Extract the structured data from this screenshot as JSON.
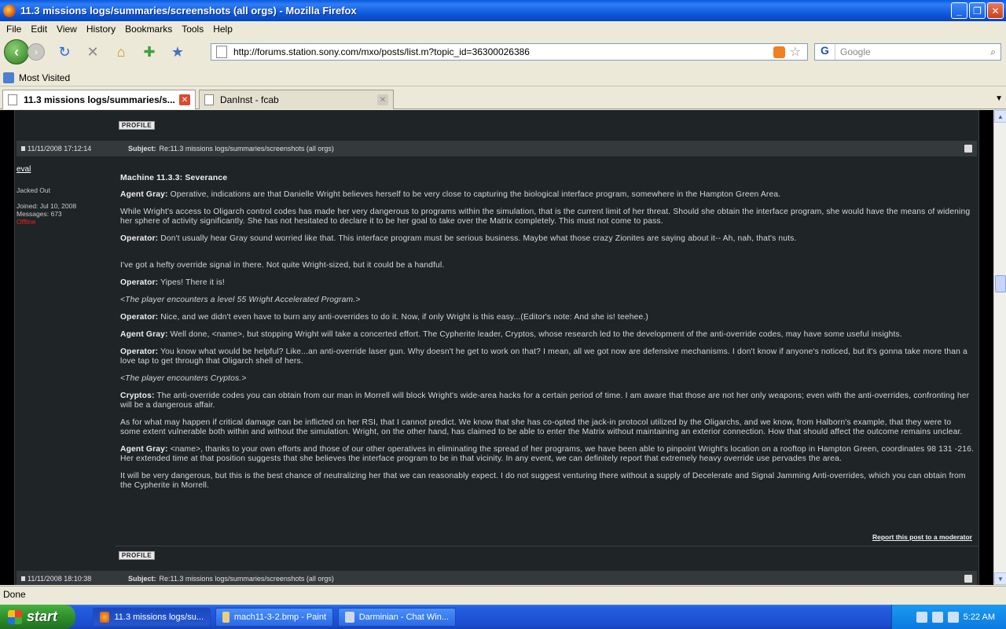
{
  "window": {
    "title": "11.3 missions logs/summaries/screenshots (all orgs) - Mozilla Firefox",
    "min": "_",
    "max": "❐",
    "close": "✕"
  },
  "menu": [
    "File",
    "Edit",
    "View",
    "History",
    "Bookmarks",
    "Tools",
    "Help"
  ],
  "nav": {
    "url": "http://forums.station.sony.com/mxo/posts/list.m?topic_id=36300026386",
    "search_placeholder": "Google",
    "search_engine": "G"
  },
  "bookmarks": {
    "most_visited": "Most Visited"
  },
  "tabs": [
    {
      "label": "11.3 missions logs/summaries/s...",
      "active": true
    },
    {
      "label": "DanInst - fcab",
      "active": false
    }
  ],
  "forum": {
    "profile_label": "PROFILE",
    "post1": {
      "date": "11/11/2008 17:12:14",
      "subject_label": "Subject:",
      "subject": "Re:11.3 missions logs/summaries/screenshots (all orgs)",
      "user": {
        "name": "eval",
        "rank": "Jacked Out",
        "joined": "Joined: Jul 10, 2008",
        "messages": "Messages: 673",
        "status": "Offline"
      },
      "heading": "Machine 11.3.3: Severance",
      "paragraphs": [
        {
          "speaker": "Agent Gray:",
          "text": " Operative, indications are that Danielle Wright believes herself to be very close to capturing the biological interface program, somewhere in the Hampton Green Area."
        },
        {
          "speaker": "",
          "text": "While Wright's access to Oligarch control codes has made her very dangerous to programs within the simulation, that is the current limit of her threat. Should she obtain the interface program, she would have the means of widening her sphere of activity significantly. She has not hesitated to declare it to be her goal to take over the Matrix completely. This must not come to pass."
        },
        {
          "speaker": "Operator:",
          "text": " Don't usually hear Gray sound worried like that. This interface program must be serious business. Maybe what those crazy Zionites are saying about it-- Ah, nah, that's nuts."
        },
        {
          "speaker": "",
          "text": "I've got a hefty override signal in there. Not quite Wright-sized, but it could be a handful."
        },
        {
          "speaker": "Operator:",
          "text": " Yipes! There it is!"
        },
        {
          "speaker": "",
          "italic": true,
          "text": "<The player encounters a level 55 Wright Accelerated Program.>"
        },
        {
          "speaker": "Operator:",
          "text": " Nice, and we didn't even have to burn any anti-overrides to do it. Now, if only Wright is this easy...(Editor's note: And she is! teehee.)"
        },
        {
          "speaker": "Agent Gray:",
          "text": " Well done, <name>, but stopping Wright will take a concerted effort. The Cypherite leader, Cryptos, whose research led to the development of the anti-override codes, may have some useful insights."
        },
        {
          "speaker": "Operator:",
          "text": " You know what would be helpful? Like...an anti-override laser gun. Why doesn't he get to work on that? I mean, all we got now are defensive mechanisms. I don't know if anyone's noticed, but it's gonna take more than a love tap to get through that Oligarch shell of hers."
        },
        {
          "speaker": "",
          "italic": true,
          "text": "<The player encounters Cryptos.>"
        },
        {
          "speaker": "Cryptos:",
          "text": " The anti-override codes you can obtain from our man in Morrell will block Wright's wide-area hacks for a certain period of time. I am aware that those are not her only weapons; even with the anti-overrides, confronting her will be a dangerous affair."
        },
        {
          "speaker": "",
          "text": "As for what may happen if critical damage can be inflicted on her RSI, that I cannot predict. We know that she has co-opted the jack-in protocol utilized by the Oligarchs, and we know, from Halborn's example, that they were to some extent vulnerable both within and without the simulation. Wright, on the other hand, has claimed to be able to enter the Matrix without maintaining an exterior connection. How that should affect the outcome remains unclear."
        },
        {
          "speaker": "Agent Gray:",
          "text": " <name>, thanks to your own efforts and those of our other operatives in eliminating the spread of her programs, we have been able to pinpoint Wright's location on a rooftop in Hampton Green, coordinates 98 131 -216. Her extended time at that position suggests that she believes the interface program to be in that vicinity. In any event, we can definitely report that extremely heavy override use pervades the area."
        },
        {
          "speaker": "",
          "text": "It will be very dangerous, but this is the best chance of neutralizing her that we can reasonably expect. I do not suggest venturing there without a supply of Decelerate and Signal Jamming Anti-overrides, which you can obtain from the Cypherite in Morrell."
        }
      ],
      "report": "Report this post to a moderator"
    },
    "post2": {
      "date": "11/11/2008 18:10:38",
      "subject_label": "Subject:",
      "subject": "Re:11.3 missions logs/summaries/screenshots (all orgs)"
    }
  },
  "status": "Done",
  "taskbar": {
    "start": "start",
    "items": [
      "11.3 missions logs/su...",
      "mach11-3-2.bmp - Paint",
      "Darminian - Chat Win..."
    ],
    "clock": "5:22 AM"
  }
}
